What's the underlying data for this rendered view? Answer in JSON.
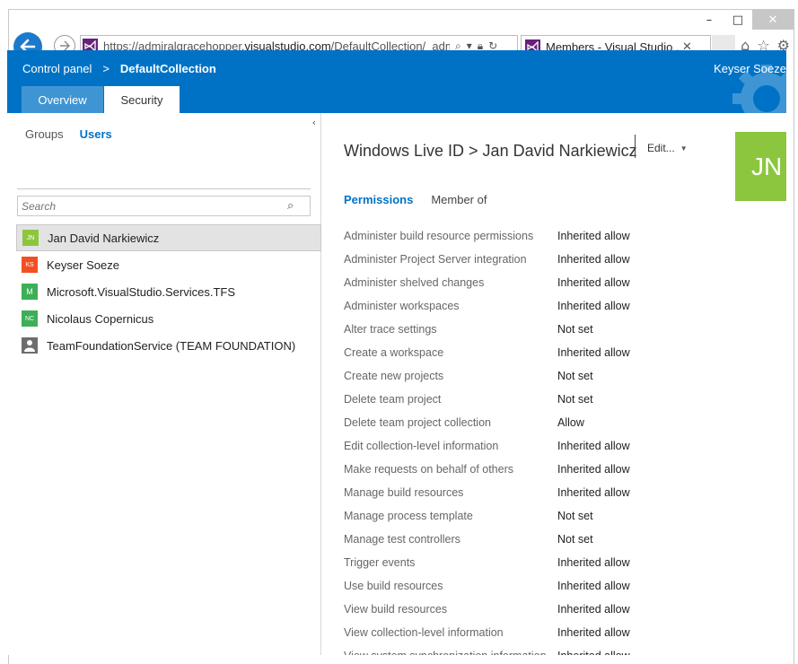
{
  "window": {
    "minimize": "–",
    "maximize": "□",
    "close": "✕"
  },
  "browser": {
    "url_prefix": "https://admiralgracehopper.",
    "url_domain": "visualstudio.com",
    "url_path": "/DefaultCollection/_admin/_",
    "tab_title": "Members - Visual Studio ...",
    "tab_close": "✕"
  },
  "header": {
    "breadcrumb_root": "Control panel",
    "breadcrumb_sep": ">",
    "breadcrumb_current": "DefaultCollection",
    "user_name": "Keyser Soeze",
    "tabs": [
      {
        "label": "Overview"
      },
      {
        "label": "Security"
      }
    ]
  },
  "left": {
    "collapse": "‹",
    "nav_groups": "Groups",
    "nav_users": "Users",
    "search_placeholder": "Search",
    "users": [
      {
        "initials": "JN",
        "name": "Jan David Narkiewicz",
        "color": "#8cc63f"
      },
      {
        "initials": "KS",
        "name": "Keyser Soeze",
        "color": "#f25022"
      },
      {
        "initials": "M",
        "name": "Microsoft.VisualStudio.Services.TFS",
        "color": "#3daf57"
      },
      {
        "initials": "NC",
        "name": "Nicolaus Copernicus",
        "color": "#3daf57"
      },
      {
        "initials": "",
        "name": "TeamFoundationService (TEAM FOUNDATION)",
        "color": "#6d6d6d"
      }
    ]
  },
  "right": {
    "title": "Windows Live ID > Jan David Narkiewicz",
    "edit_label": "Edit...",
    "edit_caret": "▼",
    "tile_initials": "JN",
    "tab_permissions": "Permissions",
    "tab_member_of": "Member of",
    "permissions": [
      {
        "name": "Administer build resource permissions",
        "value": "Inherited allow"
      },
      {
        "name": "Administer Project Server integration",
        "value": "Inherited allow"
      },
      {
        "name": "Administer shelved changes",
        "value": "Inherited allow"
      },
      {
        "name": "Administer workspaces",
        "value": "Inherited allow"
      },
      {
        "name": "Alter trace settings",
        "value": "Not set"
      },
      {
        "name": "Create a workspace",
        "value": "Inherited allow"
      },
      {
        "name": "Create new projects",
        "value": "Not set"
      },
      {
        "name": "Delete team project",
        "value": "Not set"
      },
      {
        "name": "Delete team project collection",
        "value": "Allow"
      },
      {
        "name": "Edit collection-level information",
        "value": "Inherited allow"
      },
      {
        "name": "Make requests on behalf of others",
        "value": "Inherited allow"
      },
      {
        "name": "Manage build resources",
        "value": "Inherited allow"
      },
      {
        "name": "Manage process template",
        "value": "Not set"
      },
      {
        "name": "Manage test controllers",
        "value": "Not set"
      },
      {
        "name": "Trigger events",
        "value": "Inherited allow"
      },
      {
        "name": "Use build resources",
        "value": "Inherited allow"
      },
      {
        "name": "View build resources",
        "value": "Inherited allow"
      },
      {
        "name": "View collection-level information",
        "value": "Inherited allow"
      },
      {
        "name": "View system synchronization information",
        "value": "Inherited allow"
      }
    ]
  },
  "colors": {
    "accent": "#0072c6",
    "tab_inactive": "#3f95d4",
    "tile": "#8cc63f"
  }
}
